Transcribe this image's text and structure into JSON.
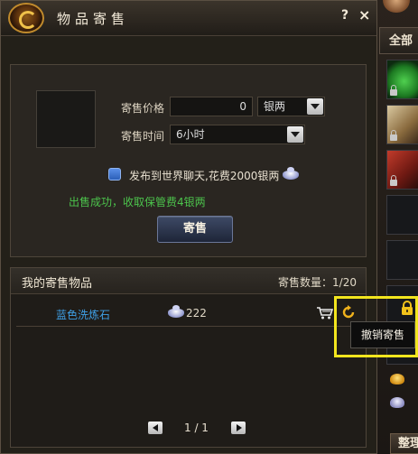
{
  "window": {
    "title": "物品寄售",
    "help_label": "?",
    "close_label": "×"
  },
  "sale_form": {
    "price_label": "寄售价格",
    "price_value": "0",
    "currency_selected": "银两",
    "duration_label": "寄售时间",
    "duration_selected": "6小时",
    "broadcast_checked": false,
    "broadcast_text": "发布到世界聊天,花费2000银两",
    "success_message": "出售成功，收取保管费4银两",
    "sell_button": "寄售"
  },
  "my_items": {
    "title": "我的寄售物品",
    "count_text": "寄售数量：1/20",
    "rows": [
      {
        "name": "蓝色洗炼石",
        "price": "222",
        "currency_icon": "silver-ingot-icon"
      }
    ],
    "pager": {
      "text": "1 / 1"
    }
  },
  "tooltip": {
    "text": "撤销寄售"
  },
  "inventory": {
    "tab_label": "全部",
    "sort_button": "整理"
  },
  "colors": {
    "success_green": "#4cc34c",
    "item_blue": "#3fa0e6",
    "highlight_yellow": "#f2e51e"
  }
}
